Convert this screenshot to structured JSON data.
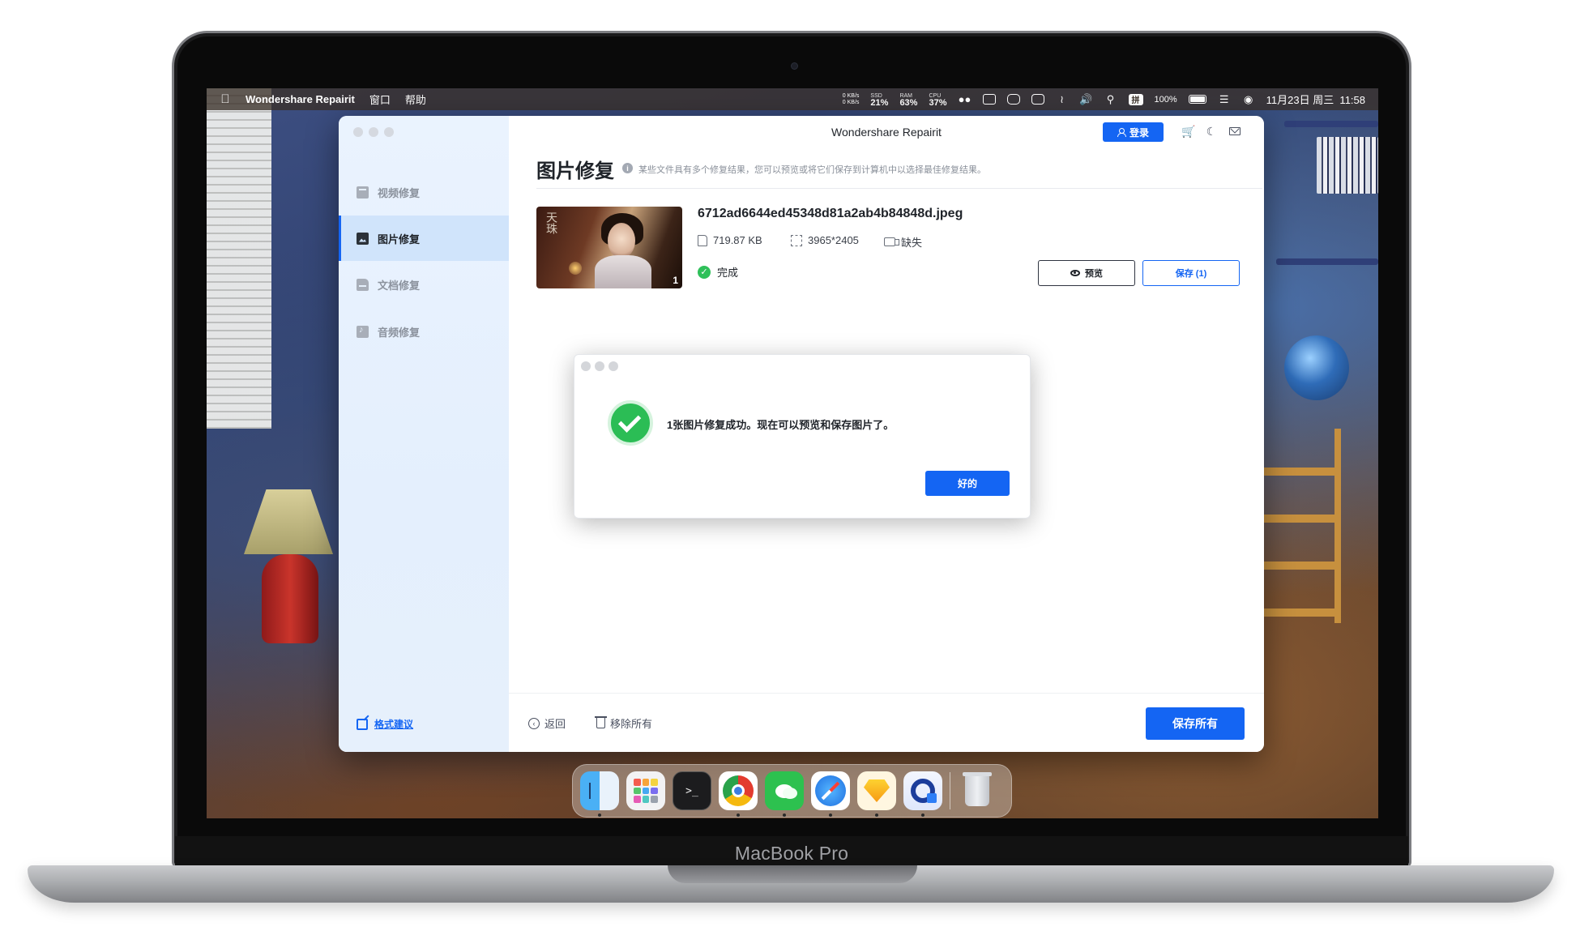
{
  "device": {
    "label": "MacBook Pro"
  },
  "menubar": {
    "app_name": "Wondershare Repairit",
    "menus": [
      "窗口",
      "帮助"
    ],
    "net_up": "0 KB/s",
    "net_down": "0 KB/s",
    "ssd_label": "SSD",
    "ssd_value": "21%",
    "ram_label": "RAM",
    "ram_value": "63%",
    "cpu_label": "CPU",
    "cpu_value": "37%",
    "ime_label": "拼",
    "battery": "100%",
    "datetime": "11月23日 周三  11:58"
  },
  "window": {
    "title": "Wondershare Repairit",
    "login_label": "登录"
  },
  "sidebar": {
    "items": [
      {
        "label": "视频修复",
        "icon": "video-repair-icon",
        "active": false
      },
      {
        "label": "图片修复",
        "icon": "image-repair-icon",
        "active": true
      },
      {
        "label": "文档修复",
        "icon": "document-repair-icon",
        "active": false
      },
      {
        "label": "音频修复",
        "icon": "audio-repair-icon",
        "active": false
      }
    ],
    "format_tip": "格式建议"
  },
  "main": {
    "page_title": "图片修复",
    "subtitle": "某些文件具有多个修复结果，您可以预览或将它们保存到计算机中以选择最佳修复结果。",
    "file": {
      "name": "6712ad6644ed45348d81a2ab4b84848d.jpeg",
      "size": "719.87 KB",
      "resolution": "3965*2405",
      "format_status": "缺失",
      "status": "完成",
      "thumb_count": "1",
      "thumb_calligraphy": "天珠"
    },
    "preview_label": "预览",
    "save_one_label": "保存 (1)",
    "back_label": "返回",
    "remove_all_label": "移除所有",
    "save_all_label": "保存所有"
  },
  "dialog": {
    "message": "1张图片修复成功。现在可以预览和保存图片了。",
    "ok_label": "好的"
  },
  "colors": {
    "accent": "#1465f3",
    "success": "#2bbd55",
    "sidebar_bg": "#e6f0fc",
    "sidebar_active": "#d0e4fb",
    "cart": "#f07a30"
  },
  "dock": [
    "finder-icon",
    "launchpad-icon",
    "terminal-icon",
    "chrome-icon",
    "wechat-icon",
    "safari-icon",
    "sketch-icon",
    "repairit-icon",
    "trash-icon"
  ]
}
